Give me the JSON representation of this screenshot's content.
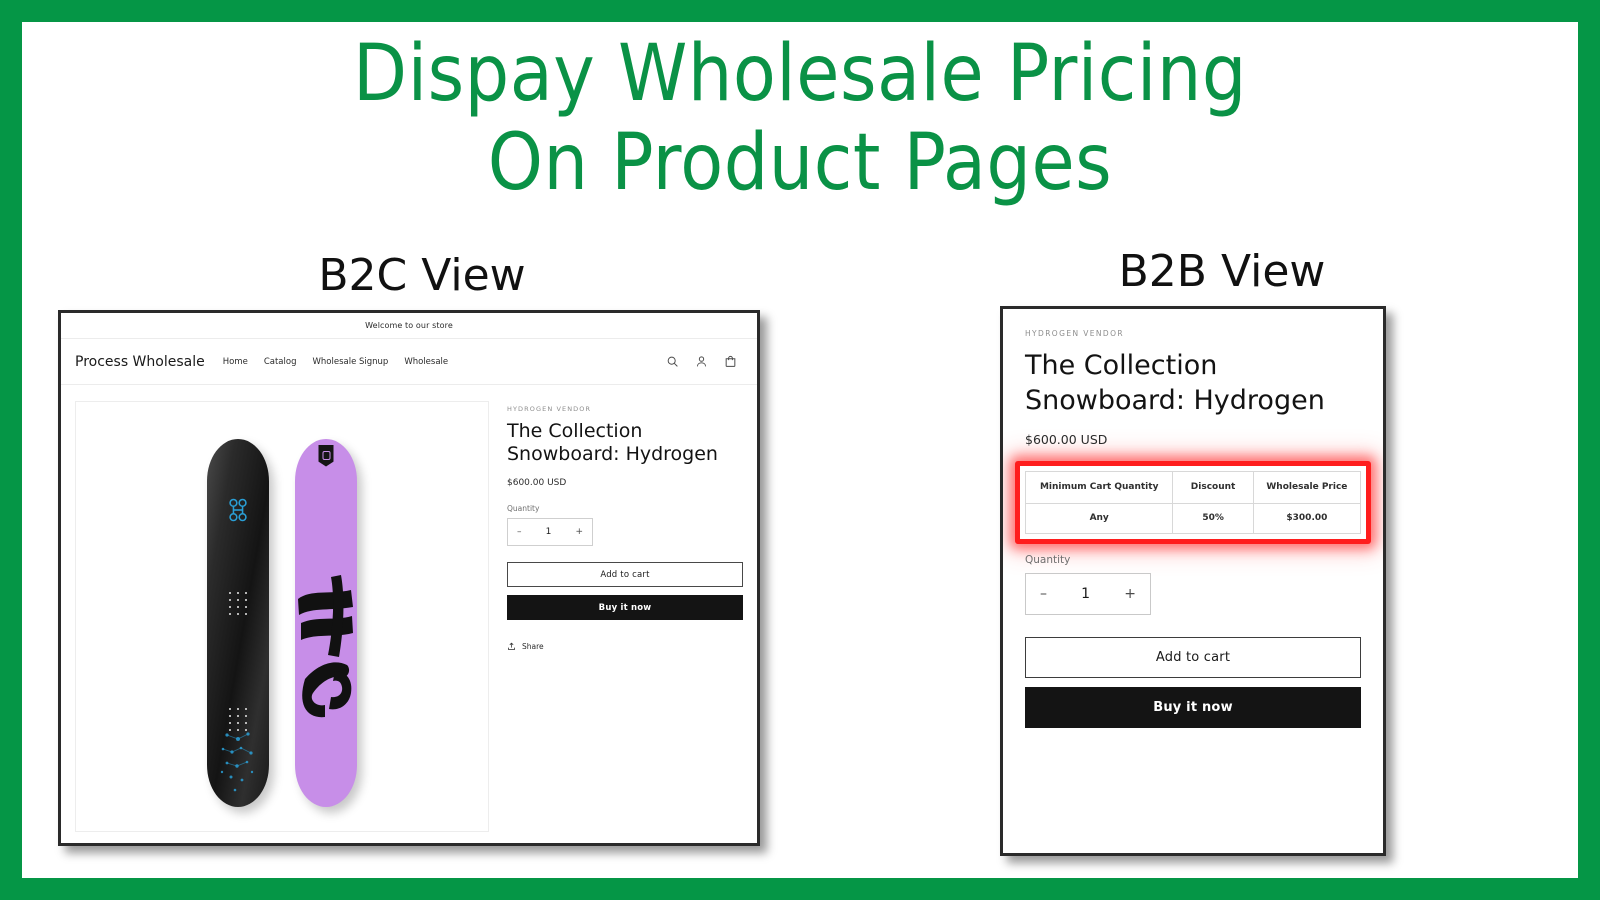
{
  "slide": {
    "title": "Dispay Wholesale Pricing\nOn Product Pages",
    "accent_color": "#059646",
    "title_color": "#0a9246",
    "highlight_color": "#ff1d1d"
  },
  "captions": {
    "b2c": "B2C View",
    "b2b": "B2B View"
  },
  "b2c": {
    "announcement": "Welcome to our store",
    "logo": "Process Wholesale",
    "nav": [
      {
        "label": "Home"
      },
      {
        "label": "Catalog"
      },
      {
        "label": "Wholesale Signup"
      },
      {
        "label": "Wholesale"
      }
    ],
    "icons": {
      "search": "search-icon",
      "account": "account-icon",
      "cart": "cart-icon"
    },
    "product": {
      "vendor": "HYDROGEN VENDOR",
      "title": "The Collection Snowboard: Hydrogen",
      "price": "$600.00 USD",
      "quantity_label": "Quantity",
      "quantity_value": "1",
      "minus": "–",
      "plus": "+",
      "add_to_cart": "Add to cart",
      "buy_it_now": "Buy it now",
      "share": "Share"
    },
    "gallery": {
      "board_dark_color": "#1a1a1a",
      "board_purple_color": "#c78ee8",
      "molecule_color": "#2a9fd6"
    }
  },
  "b2b": {
    "product": {
      "vendor": "HYDROGEN VENDOR",
      "title": "The Collection Snowboard: Hydrogen",
      "price": "$600.00 USD",
      "quantity_label": "Quantity",
      "quantity_value": "1",
      "minus": "–",
      "plus": "+",
      "add_to_cart": "Add to cart",
      "buy_it_now": "Buy it now"
    },
    "wholesale_table": {
      "headers": [
        "Minimum Cart Quantity",
        "Discount",
        "Wholesale Price"
      ],
      "rows": [
        {
          "min_qty": "Any",
          "discount": "50%",
          "price": "$300.00"
        }
      ]
    }
  }
}
